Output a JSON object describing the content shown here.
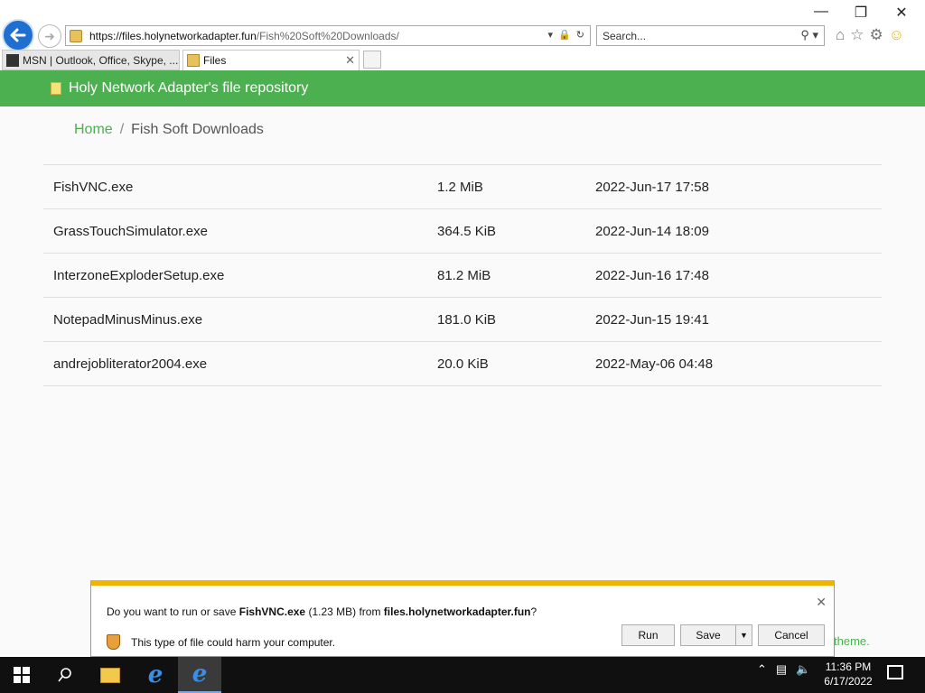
{
  "browser": {
    "url_domain": "https://files.holynetworkadapter.fun",
    "url_path": "/Fish%20Soft%20Downloads/",
    "search_placeholder": "Search...",
    "tabs": [
      {
        "label": "MSN | Outlook, Office, Skype, ..."
      },
      {
        "label": "Files"
      }
    ],
    "window_controls": {
      "minimize": "—",
      "restore": "❐",
      "close": "✕"
    }
  },
  "site": {
    "title": "Holy Network Adapter's file repository",
    "breadcrumb": {
      "home": "Home",
      "separator": "/",
      "current": "Fish Soft Downloads"
    },
    "files": [
      {
        "name": "FishVNC.exe",
        "size": "1.2 MiB",
        "date": "2022-Jun-17 17:58"
      },
      {
        "name": "GrassTouchSimulator.exe",
        "size": "364.5 KiB",
        "date": "2022-Jun-14 18:09"
      },
      {
        "name": "InterzoneExploderSetup.exe",
        "size": "81.2 MiB",
        "date": "2022-Jun-16 17:48"
      },
      {
        "name": "NotepadMinusMinus.exe",
        "size": "181.0 KiB",
        "date": "2022-Jun-15 19:41"
      },
      {
        "name": "andrejobliterator2004.exe",
        "size": "20.0 KiB",
        "date": "2022-May-06 04:48"
      }
    ],
    "footer_fragment": "theme."
  },
  "download_bar": {
    "prompt_prefix": "Do you want to run or save ",
    "file_name": "FishVNC.exe",
    "file_size": " (1.23 MB) from ",
    "source": "files.holynetworkadapter.fun",
    "prompt_suffix": "?",
    "warning": "This type of file could harm your computer.",
    "run_label": "Run",
    "save_label": "Save",
    "cancel_label": "Cancel",
    "close_glyph": "✕"
  },
  "taskbar": {
    "time": "11:36 PM",
    "date": "6/17/2022"
  },
  "colors": {
    "accent": "#4caf50",
    "warning_stripe": "#f0b400",
    "back_button": "#1e6fd0"
  }
}
